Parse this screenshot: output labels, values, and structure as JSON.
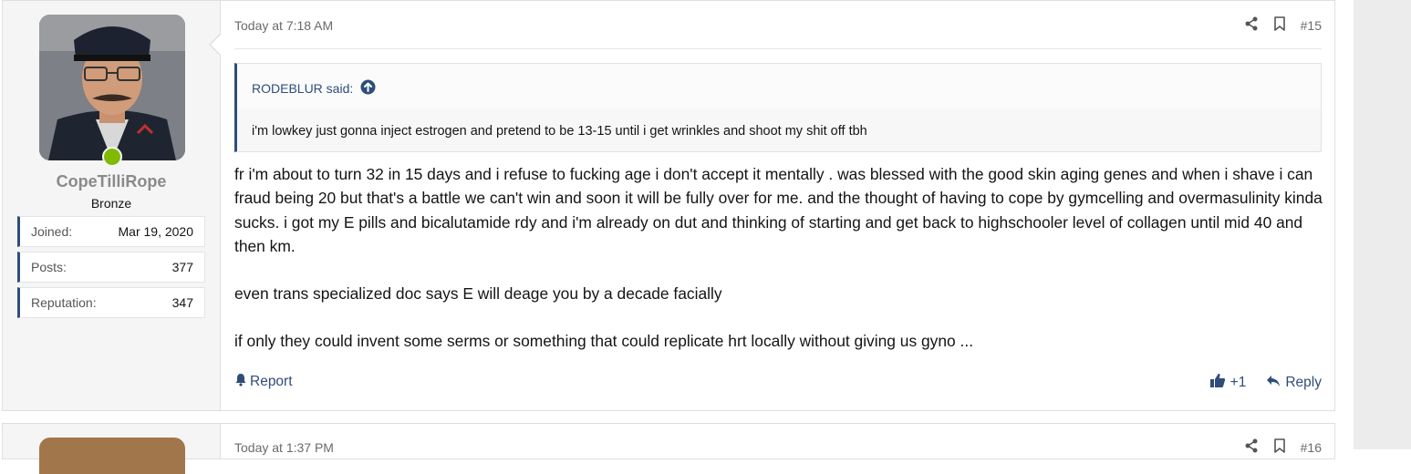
{
  "posts": [
    {
      "date": "Today at 7:18 AM",
      "number": "#15",
      "user": {
        "name": "CopeTilliRope",
        "title": "Bronze",
        "stats": [
          {
            "label": "Joined:",
            "value": "Mar 19, 2020"
          },
          {
            "label": "Posts:",
            "value": "377"
          },
          {
            "label": "Reputation:",
            "value": "347"
          }
        ]
      },
      "quote": {
        "author": "RODEBLUR said:",
        "text": "i'm lowkey just gonna inject estrogen and pretend to be 13-15 until i get wrinkles and shoot my shit off tbh"
      },
      "paragraphs": [
        "fr i'm about to turn 32 in 15 days and i refuse to fucking age i don't accept it mentally . was blessed with the good skin aging genes and when i shave i can fraud being 20 but that's a battle we can't win and soon it will be fully over for me. and the thought of having to cope by gymcelling and overmasulinity kinda sucks. i got my E pills and bicalutamide rdy and i'm already on dut and thinking of starting and get back to highschooler level of collagen until mid 40 and then km.",
        "even trans specialized doc says E will deage you by a decade facially",
        "if only they could invent some serms or something that could replicate hrt locally without giving us gyno ..."
      ],
      "actions": {
        "report": "Report",
        "like_count": "+1",
        "reply": "Reply"
      }
    },
    {
      "date": "Today at 1:37 PM",
      "number": "#16"
    }
  ],
  "icons": {
    "share": "share-icon",
    "bookmark": "bookmark-icon",
    "quote_jump": "arrow-up-circle-icon",
    "report": "bell-icon",
    "like": "thumbs-up-icon",
    "reply": "reply-icon"
  },
  "colors": {
    "accent": "#2f4d7a",
    "online": "#7fba00",
    "username": "#8a8a8a"
  }
}
